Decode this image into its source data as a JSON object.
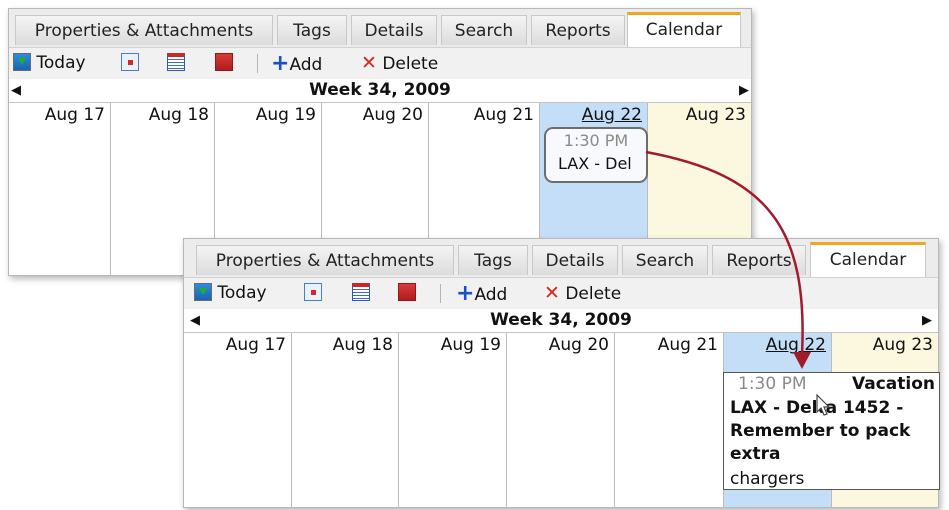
{
  "tabs": [
    "Properties & Attachments",
    "Tags",
    "Details",
    "Search",
    "Reports",
    "Calendar"
  ],
  "active_tab": "Calendar",
  "toolbar": {
    "today_label": "Today",
    "add_label": "Add",
    "delete_label": "Delete",
    "icons": [
      "today-icon",
      "day-view-icon",
      "week-view-icon",
      "month-view-icon",
      "add-icon",
      "delete-icon"
    ]
  },
  "week_title": "Week 34, 2009",
  "days": [
    "Aug 17",
    "Aug 18",
    "Aug 19",
    "Aug 20",
    "Aug 21",
    "Aug 22",
    "Aug 23"
  ],
  "highlighted_day": "Aug 22",
  "colors": {
    "accent_tab": "#f3a51e",
    "today_column": "#c5def8",
    "weekend_column": "#fbf8df",
    "connector_arrow": "#a01c2c"
  },
  "appointment": {
    "time": "1:30 PM",
    "short_text": "LAX - Del",
    "tag": "Vacation",
    "full_text": "LAX - Delta 1452 - Remember to pack extra",
    "overflow_text": "chargers"
  }
}
